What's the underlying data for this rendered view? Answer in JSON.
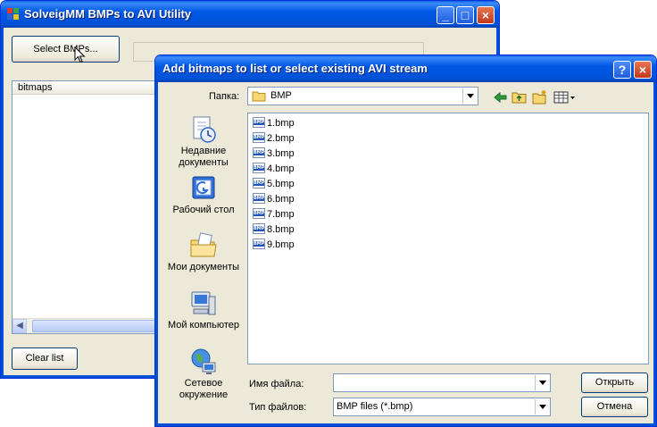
{
  "main_window": {
    "title": "SolveigMM BMPs to AVI Utility",
    "select_button": "Select BMPs...",
    "list_header": "bitmaps",
    "clear_button": "Clear list",
    "title_buttons": {
      "minimize": "_",
      "maximize": "□",
      "close": "×"
    }
  },
  "dialog": {
    "title": "Add bitmaps to list or select existing AVI stream",
    "title_buttons": {
      "help": "?",
      "close": "×"
    },
    "folder_label": "Папка:",
    "folder_value": "BMP",
    "places": [
      {
        "label": "Недавние документы",
        "icon": "recent-docs-icon"
      },
      {
        "label": "Рабочий стол",
        "icon": "desktop-icon"
      },
      {
        "label": "Мои документы",
        "icon": "my-documents-icon"
      },
      {
        "label": "Мой компьютер",
        "icon": "my-computer-icon"
      },
      {
        "label": "Сетевое окружение",
        "icon": "network-icon"
      }
    ],
    "files": [
      "1.bmp",
      "2.bmp",
      "3.bmp",
      "4.bmp",
      "5.bmp",
      "6.bmp",
      "7.bmp",
      "8.bmp",
      "9.bmp"
    ],
    "filename_label": "Имя файла:",
    "filename_value": "",
    "filetype_label": "Тип файлов:",
    "filetype_value": "BMP files (*.bmp)",
    "open_button": "Открыть",
    "cancel_button": "Отмена"
  },
  "colors": {
    "title_blue": "#0058e6",
    "face": "#ece9d8",
    "close_red": "#c2381a",
    "field_border": "#7f9db9"
  }
}
